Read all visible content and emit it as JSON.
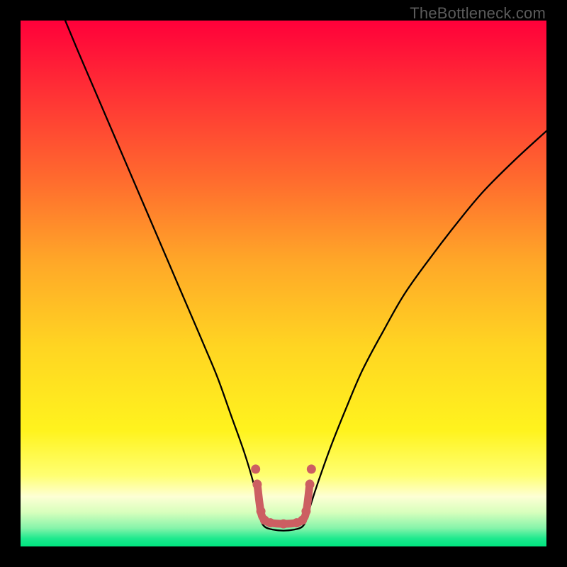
{
  "watermark": "TheBottleneck.com",
  "chart_data": {
    "type": "line",
    "title": "",
    "xlabel": "",
    "ylabel": "",
    "x_range_pct": [
      0,
      100
    ],
    "y_range_pct": [
      0,
      100
    ],
    "background_gradient": {
      "stops": [
        {
          "pos": 0.0,
          "color": "#ff003a"
        },
        {
          "pos": 0.14,
          "color": "#ff3235"
        },
        {
          "pos": 0.3,
          "color": "#ff6a2e"
        },
        {
          "pos": 0.46,
          "color": "#ffa828"
        },
        {
          "pos": 0.62,
          "color": "#ffd522"
        },
        {
          "pos": 0.78,
          "color": "#fff31e"
        },
        {
          "pos": 0.865,
          "color": "#ffff72"
        },
        {
          "pos": 0.905,
          "color": "#fdffd4"
        },
        {
          "pos": 0.935,
          "color": "#d8ffbd"
        },
        {
          "pos": 0.965,
          "color": "#86f4aa"
        },
        {
          "pos": 0.985,
          "color": "#1de98e"
        },
        {
          "pos": 1.0,
          "color": "#00e57f"
        }
      ]
    },
    "series": [
      {
        "name": "bottleneck-curve",
        "type": "line",
        "stroke": "#000000",
        "stroke_width": 2.3,
        "points_pct": [
          [
            8.5,
            0.0
          ],
          [
            11.0,
            6.0
          ],
          [
            14.0,
            13.0
          ],
          [
            17.0,
            20.0
          ],
          [
            20.0,
            27.0
          ],
          [
            23.0,
            34.0
          ],
          [
            26.0,
            41.0
          ],
          [
            29.0,
            48.0
          ],
          [
            32.0,
            55.0
          ],
          [
            35.0,
            62.0
          ],
          [
            37.5,
            68.0
          ],
          [
            40.0,
            75.0
          ],
          [
            42.5,
            82.0
          ],
          [
            44.3,
            88.0
          ],
          [
            45.3,
            92.5
          ],
          [
            45.7,
            95.0
          ],
          [
            46.5,
            96.3
          ],
          [
            48.0,
            96.8
          ],
          [
            50.0,
            97.0
          ],
          [
            52.0,
            96.8
          ],
          [
            53.5,
            96.3
          ],
          [
            54.3,
            95.0
          ],
          [
            55.2,
            92.0
          ],
          [
            56.5,
            88.0
          ],
          [
            59.0,
            81.0
          ],
          [
            62.0,
            73.5
          ],
          [
            65.0,
            66.5
          ],
          [
            69.0,
            59.0
          ],
          [
            73.0,
            52.0
          ],
          [
            78.0,
            45.0
          ],
          [
            83.0,
            38.5
          ],
          [
            88.0,
            32.5
          ],
          [
            94.0,
            26.5
          ],
          [
            100.0,
            21.0
          ]
        ]
      },
      {
        "name": "flat-bottom-marker",
        "type": "line",
        "stroke": "#cc5e62",
        "stroke_width": 11,
        "linecap": "round",
        "points_pct": [
          [
            45.0,
            88.0
          ],
          [
            45.7,
            93.5
          ],
          [
            46.5,
            95.0
          ],
          [
            47.5,
            95.5
          ],
          [
            50.0,
            95.7
          ],
          [
            52.5,
            95.5
          ],
          [
            53.5,
            95.0
          ],
          [
            54.3,
            93.5
          ],
          [
            55.0,
            88.0
          ]
        ]
      }
    ],
    "marker_dots": {
      "fill": "#cc5e62",
      "radius": 6.5,
      "points_pct": [
        [
          44.7,
          85.3
        ],
        [
          45.0,
          88.2
        ],
        [
          45.7,
          93.3
        ],
        [
          46.4,
          95.0
        ],
        [
          47.5,
          95.5
        ],
        [
          50.0,
          95.7
        ],
        [
          52.5,
          95.5
        ],
        [
          53.6,
          95.0
        ],
        [
          54.3,
          93.3
        ],
        [
          55.0,
          88.2
        ],
        [
          55.3,
          85.3
        ]
      ]
    }
  }
}
